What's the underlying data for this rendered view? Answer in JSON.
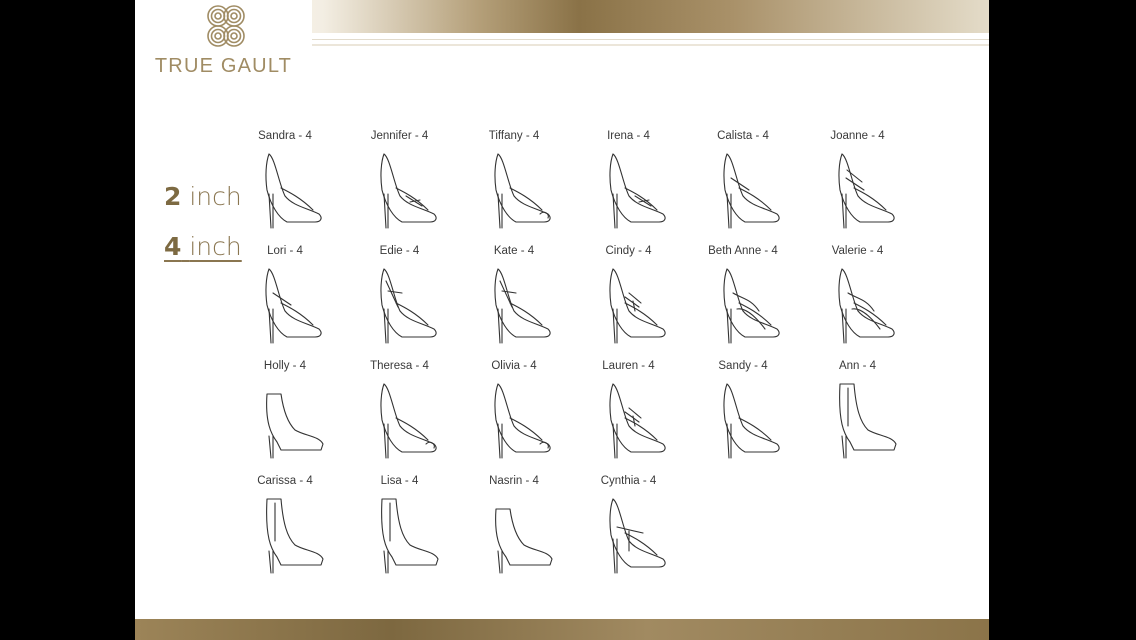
{
  "brand": {
    "name": "TRUE GAULT"
  },
  "heel_options": [
    {
      "value": "2",
      "unit": "inch",
      "selected": false
    },
    {
      "value": "4",
      "unit": "inch",
      "selected": true
    }
  ],
  "shoes": [
    {
      "name": "Sandra - 4",
      "type": "pump"
    },
    {
      "name": "Jennifer - 4",
      "type": "pump-loafer"
    },
    {
      "name": "Tiffany - 4",
      "type": "peeptoe"
    },
    {
      "name": "Irena - 4",
      "type": "loafer"
    },
    {
      "name": "Calista - 4",
      "type": "maryjane"
    },
    {
      "name": "Joanne - 4",
      "type": "double-strap"
    },
    {
      "name": "Lori - 4",
      "type": "maryjane"
    },
    {
      "name": "Edie - 4",
      "type": "tstrap"
    },
    {
      "name": "Kate - 4",
      "type": "tstrap"
    },
    {
      "name": "Cindy - 4",
      "type": "laceup"
    },
    {
      "name": "Beth Anne - 4",
      "type": "cutout"
    },
    {
      "name": "Valerie - 4",
      "type": "cutout"
    },
    {
      "name": "Holly - 4",
      "type": "bootie"
    },
    {
      "name": "Theresa - 4",
      "type": "peeptoe"
    },
    {
      "name": "Olivia - 4",
      "type": "peeptoe"
    },
    {
      "name": "Lauren - 4",
      "type": "laceup"
    },
    {
      "name": "Sandy - 4",
      "type": "pump"
    },
    {
      "name": "Ann - 4",
      "type": "ankle-boot"
    },
    {
      "name": "Carissa - 4",
      "type": "ankle-boot"
    },
    {
      "name": "Lisa - 4",
      "type": "ankle-boot"
    },
    {
      "name": "Nasrin - 4",
      "type": "bootie"
    },
    {
      "name": "Cynthia - 4",
      "type": "oxford"
    }
  ],
  "colors": {
    "gold": "#a08c64",
    "text": "#3a3a3a"
  }
}
